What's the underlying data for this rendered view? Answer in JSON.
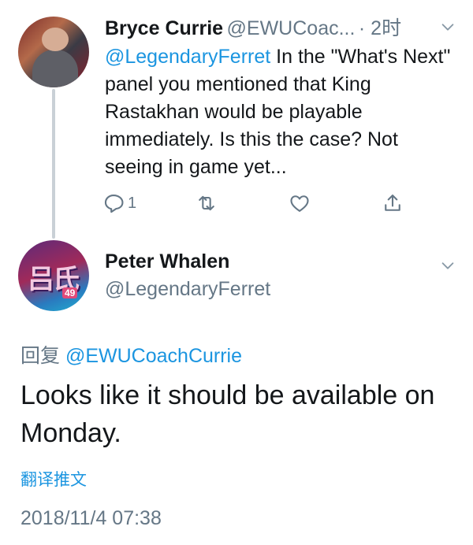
{
  "tweet": {
    "author_name": "Bryce Currie",
    "author_handle": "@EWUCoac...",
    "time_ago": "· 2时",
    "mention": "@LegendaryFerret",
    "text": " In the \"What's Next\" panel you mentioned that King Rastakhan would be playable immediately. Is this the case? Not seeing in game yet...",
    "reply_count": "1"
  },
  "reply": {
    "author_name": "Peter Whalen",
    "author_handle": "@LegendaryFerret",
    "reply_to_label": "回复",
    "reply_to_handle": "@EWUCoachCurrie",
    "text": "Looks like it should be available on Monday.",
    "translate_label": "翻译推文",
    "timestamp": "2018/11/4 07:38",
    "avatar_glyph": "吕氏",
    "avatar_tag": "49"
  },
  "colors": {
    "accent": "#1b95e0",
    "secondary_text": "#657786",
    "primary_text": "#14171a",
    "thread_line": "#c9d0d6"
  },
  "icons": {
    "reply": "reply-icon",
    "retweet": "retweet-icon",
    "like": "heart-icon",
    "share": "share-icon",
    "menu": "chevron-down-icon"
  }
}
